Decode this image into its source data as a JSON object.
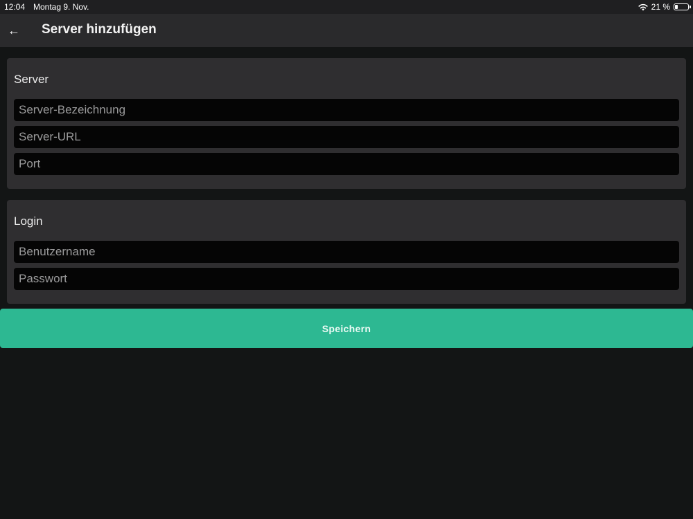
{
  "status_bar": {
    "time": "12:04",
    "date": "Montag 9. Nov.",
    "battery_text": "21 %",
    "battery_level": 0.21
  },
  "header": {
    "back_icon": "arrow-left-icon",
    "title": "Server hinzufügen"
  },
  "server_section": {
    "title": "Server",
    "fields": {
      "name_placeholder": "Server-Bezeichnung",
      "url_placeholder": "Server-URL",
      "port_placeholder": "Port"
    }
  },
  "login_section": {
    "title": "Login",
    "fields": {
      "username_placeholder": "Benutzername",
      "password_placeholder": "Passwort"
    }
  },
  "save_button": {
    "label": "Speichern",
    "color": "#2db892"
  }
}
